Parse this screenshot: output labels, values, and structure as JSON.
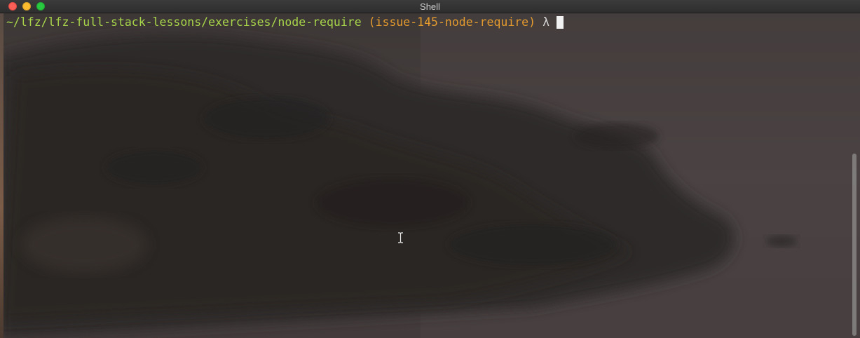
{
  "window": {
    "title": "Shell"
  },
  "terminal": {
    "path": "~/lfz/lfz-full-stack-lessons/exercises/node-require",
    "branch": "(issue-145-node-require)",
    "prompt_symbol": "λ"
  },
  "colors": {
    "path": "#a8d64a",
    "branch": "#e39a2e",
    "background": "#3a3432"
  },
  "icons": {
    "close": "close-icon",
    "minimize": "minimize-icon",
    "maximize": "maximize-icon",
    "text_cursor": "ibeam-cursor-icon"
  }
}
